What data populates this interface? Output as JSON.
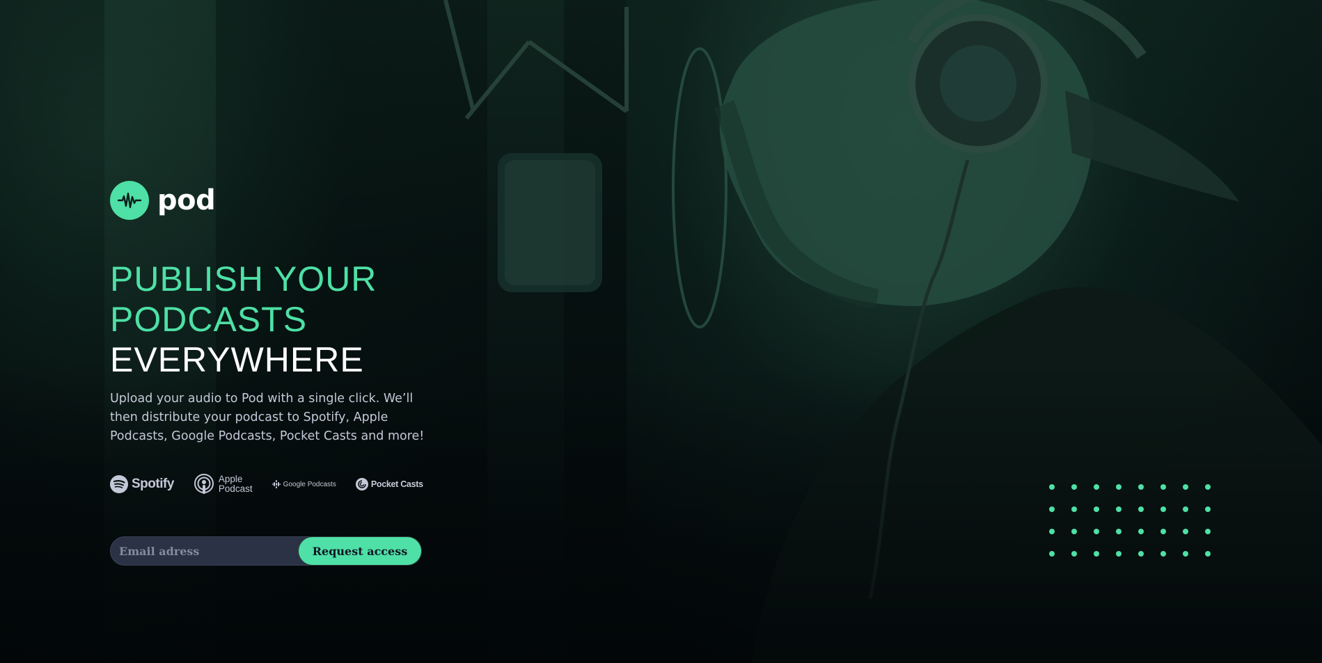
{
  "brand": {
    "name": "pod",
    "accent_color": "#4ee0a6",
    "logo_icon": "sound-wave-icon"
  },
  "hero": {
    "headline_accent_line1": "PUBLISH YOUR",
    "headline_accent_line2": "PODCASTS",
    "headline_white": "EVERYWHERE",
    "description": "Upload your audio to Pod with a single click. We’ll then distribute your podcast to Spotify, Apple Podcasts, Google Podcasts, Pocket Casts and more!"
  },
  "platforms": {
    "spotify": "Spotify",
    "apple_line1": "Apple",
    "apple_line2": "Podcast",
    "google": "Google Podcasts",
    "pocket": "Pocket Casts"
  },
  "signup": {
    "email_placeholder": "Email adress",
    "email_value": "",
    "button_label": "Request access"
  },
  "decoration": {
    "dot_grid_rows": 4,
    "dot_grid_cols": 8,
    "background_image": "man-with-headphones-and-studio-microphone"
  }
}
